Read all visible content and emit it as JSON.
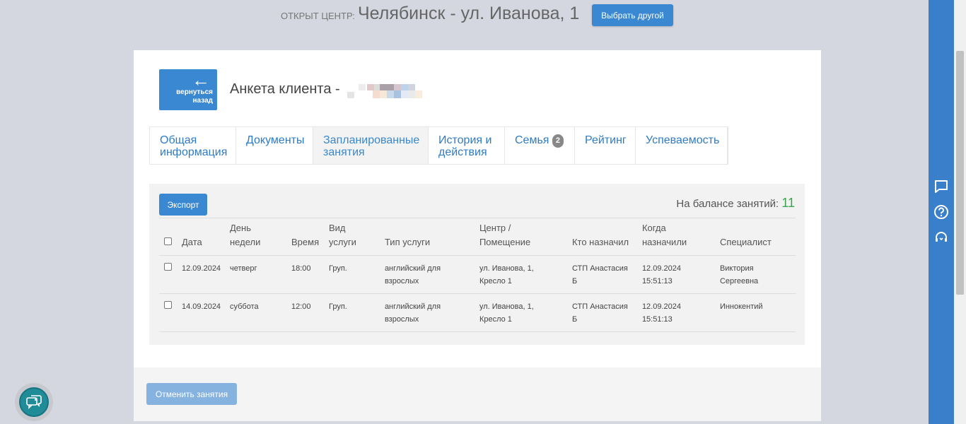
{
  "header": {
    "center_label": "ОТКРЫТ ЦЕНТР:",
    "center_name": "Челябинск - ул. Иванова, 1",
    "choose_other": "Выбрать другой"
  },
  "client": {
    "back_arrow": "←",
    "back_label": "вернуться назад",
    "title": "Анкета клиента -"
  },
  "tabs": [
    {
      "label": "Общая информация"
    },
    {
      "label": "Документы"
    },
    {
      "label": "Запланированные занятия"
    },
    {
      "label": "История и действия"
    },
    {
      "label": "Семья",
      "badge": "2"
    },
    {
      "label": "Рейтинг"
    },
    {
      "label": "Успеваемость"
    }
  ],
  "panel": {
    "export": "Экспорт",
    "balance_label": "На балансе занятий:",
    "balance_value": "11"
  },
  "table": {
    "columns": [
      "Дата",
      "День недели",
      "Время",
      "Вид услуги",
      "Тип услуги",
      "Центр / Помещение",
      "Кто назначил",
      "Когда назначили",
      "Специалист"
    ],
    "rows": [
      [
        "12.09.2024",
        "четверг",
        "18:00",
        "Груп.",
        "английский для взрослых",
        "ул. Иванова, 1, Кресло 1",
        "СТП Анастасия Б",
        "12.09.2024 15:51:13",
        "Виктория Сергеевна"
      ],
      [
        "14.09.2024",
        "суббота",
        "12:00",
        "Груп.",
        "английский для взрослых",
        "ул. Иванова, 1, Кресло 1",
        "СТП Анастасия Б",
        "12.09.2024 15:51:13",
        "Иннокентий"
      ]
    ]
  },
  "footer": {
    "cancel": "Отменить занятия"
  },
  "icons": {
    "chat": "chat-icon",
    "help": "help-icon",
    "support": "headset-icon",
    "floating": "support-chat-icon"
  }
}
